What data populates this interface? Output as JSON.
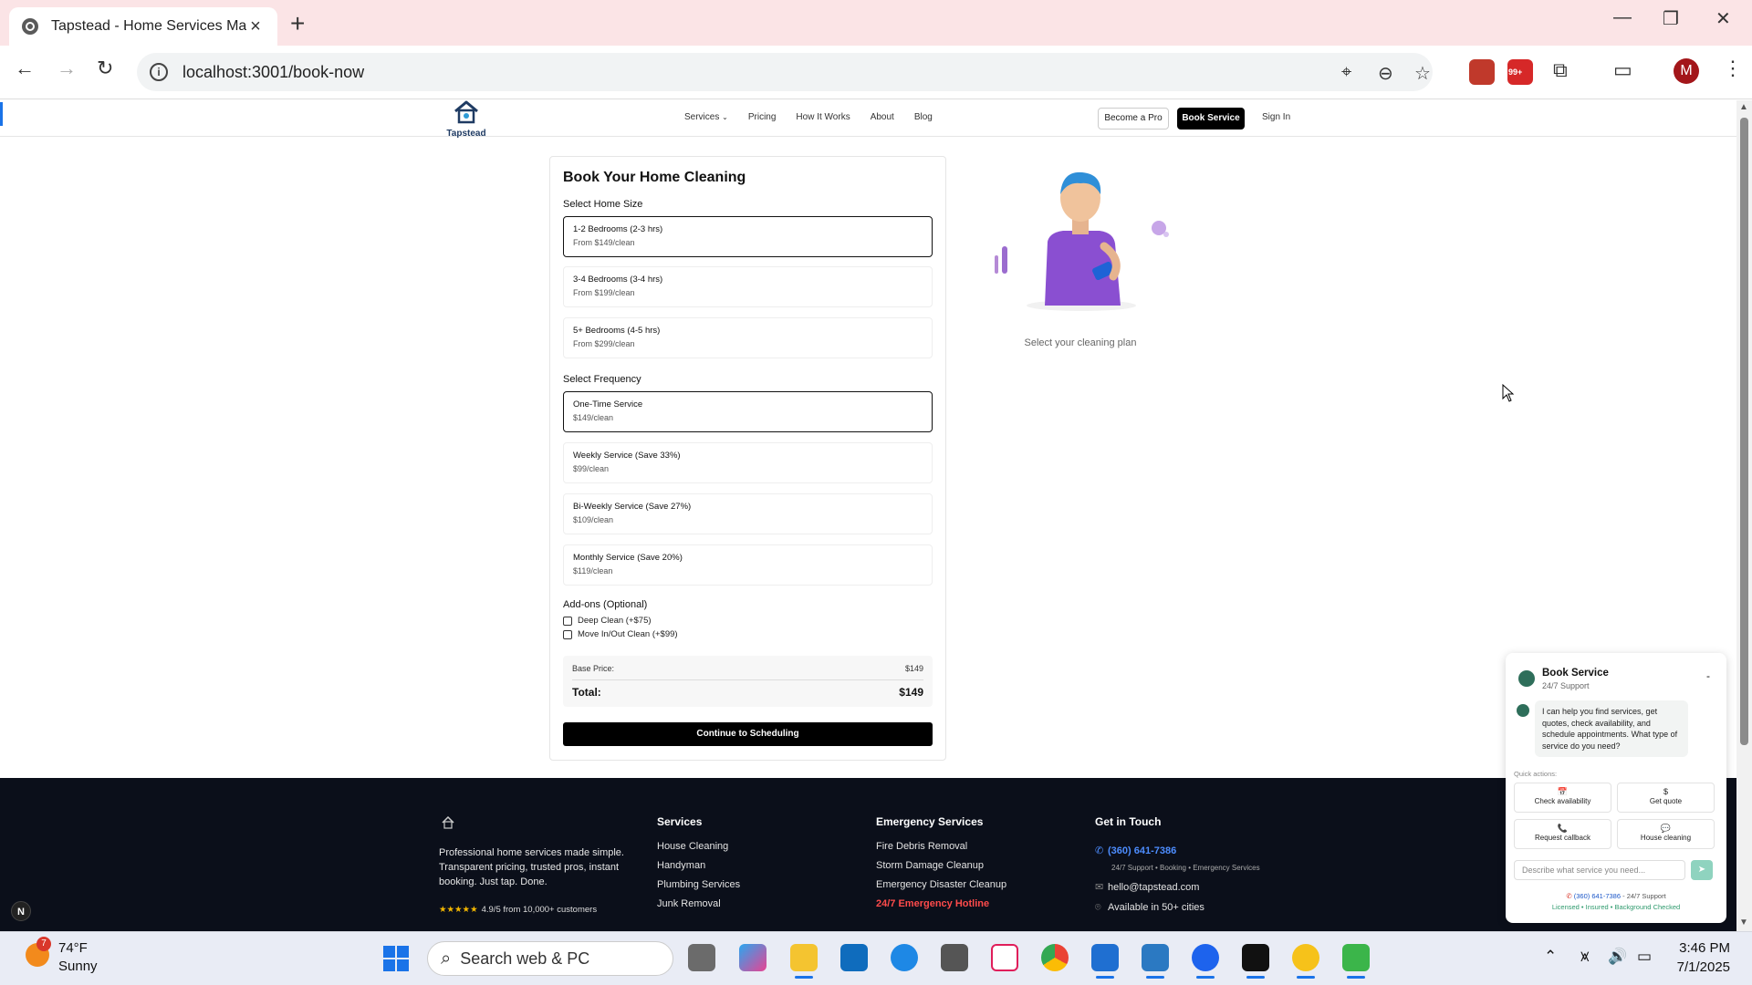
{
  "browser": {
    "tab_title": "Tapstead - Home Services Made",
    "url": "localhost:3001/book-now",
    "new_tab": "+",
    "profile_initial": "M",
    "ext_badge": "99+"
  },
  "site": {
    "logo_text": "Tapstead",
    "nav": [
      "Services",
      "Pricing",
      "How It Works",
      "About",
      "Blog"
    ],
    "become_pro": "Become a Pro",
    "book_service": "Book Service",
    "sign_in": "Sign In"
  },
  "booking": {
    "title": "Book Your Home Cleaning",
    "home_size_label": "Select Home Size",
    "home_sizes": [
      {
        "title": "1-2 Bedrooms (2-3 hrs)",
        "sub": "From $149/clean",
        "selected": true
      },
      {
        "title": "3-4 Bedrooms (3-4 hrs)",
        "sub": "From $199/clean",
        "selected": false
      },
      {
        "title": "5+ Bedrooms (4-5 hrs)",
        "sub": "From $299/clean",
        "selected": false
      }
    ],
    "frequency_label": "Select Frequency",
    "frequencies": [
      {
        "title": "One-Time Service",
        "sub": "$149/clean",
        "selected": true
      },
      {
        "title": "Weekly Service (Save 33%)",
        "sub": "$99/clean",
        "selected": false
      },
      {
        "title": "Bi-Weekly Service (Save 27%)",
        "sub": "$109/clean",
        "selected": false
      },
      {
        "title": "Monthly Service (Save 20%)",
        "sub": "$119/clean",
        "selected": false
      }
    ],
    "addons_label": "Add-ons (Optional)",
    "addons": [
      {
        "label": "Deep Clean (+$75)",
        "checked": false
      },
      {
        "label": "Move In/Out Clean (+$99)",
        "checked": false
      }
    ],
    "base_price_label": "Base Price:",
    "base_price": "$149",
    "total_label": "Total:",
    "total": "$149",
    "continue_label": "Continue to Scheduling",
    "plan_caption": "Select your cleaning plan"
  },
  "footer": {
    "description": "Professional home services made simple. Transparent pricing, trusted pros, instant booking. Just tap. Done.",
    "rating": "4.9/5 from 10,000+ customers",
    "services_heading": "Services",
    "services": [
      "House Cleaning",
      "Handyman",
      "Plumbing Services",
      "Junk Removal"
    ],
    "emergency_heading": "Emergency Services",
    "emergency": [
      "Fire Debris Removal",
      "Storm Damage Cleanup",
      "Emergency Disaster Cleanup",
      "24/7 Emergency Hotline"
    ],
    "contact_heading": "Get in Touch",
    "phone": "(360) 641-7386",
    "phone_sub": "24/7 Support • Booking • Emergency Services",
    "email": "hello@tapstead.com",
    "availability": "Available in 50+ cities",
    "n_badge": "N"
  },
  "chat": {
    "title": "Book Service",
    "subtitle": "24/7 Support",
    "minimize": "-",
    "message": "I can help you find services, get quotes, check availability, and schedule appointments. What type of service do you need?",
    "quick_actions_label": "Quick actions:",
    "quick_actions": [
      {
        "icon": "📅",
        "label": "Check availability"
      },
      {
        "icon": "$",
        "label": "Get quote"
      },
      {
        "icon": "📞",
        "label": "Request callback"
      },
      {
        "icon": "💬",
        "label": "House cleaning"
      }
    ],
    "input_placeholder": "Describe what service you need...",
    "footer_phone": "(360) 641-7386",
    "footer_phone_suffix": "- 24/7 Support",
    "footer_badges": "Licensed • Insured • Background Checked"
  },
  "taskbar": {
    "temp": "74°F",
    "condition": "Sunny",
    "weather_badge": "7",
    "search_placeholder": "Search web & PC",
    "time": "3:46 PM",
    "date": "7/1/2025"
  },
  "colors": {
    "accent_blue": "#4d8dff",
    "emergency_red": "#ff4b4b",
    "footer_bg": "#0b0f1a",
    "chat_green": "#2e6e5a"
  }
}
